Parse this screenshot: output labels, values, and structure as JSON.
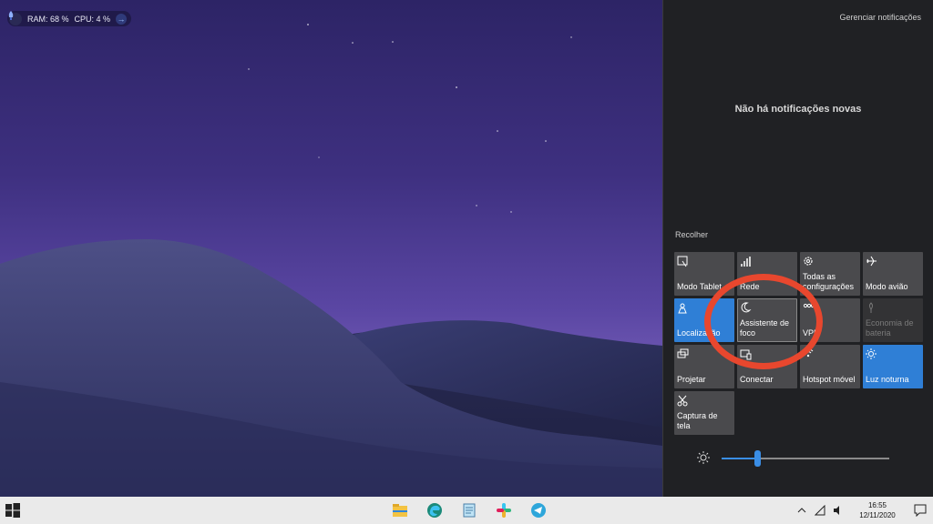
{
  "monitor": {
    "ram": "RAM: 68 %",
    "cpu": "CPU: 4 %"
  },
  "action_center": {
    "manage_link": "Gerenciar notificações",
    "empty_message": "Não há notificações novas",
    "collapse_link": "Recolher",
    "tiles": [
      {
        "label": "Modo Tablet",
        "icon": "tablet-mode-icon",
        "state": "off"
      },
      {
        "label": "Rede",
        "icon": "network-icon",
        "state": "off"
      },
      {
        "label": "Todas as configurações",
        "icon": "settings-gear-icon",
        "state": "off"
      },
      {
        "label": "Modo avião",
        "icon": "airplane-icon",
        "state": "off"
      },
      {
        "label": "Localização",
        "icon": "location-icon",
        "state": "on"
      },
      {
        "label": "Assistente de foco",
        "icon": "moon-icon",
        "state": "off"
      },
      {
        "label": "VPN",
        "icon": "vpn-icon",
        "state": "off"
      },
      {
        "label": "Economia de bateria",
        "icon": "battery-saver-icon",
        "state": "disabled"
      },
      {
        "label": "Projetar",
        "icon": "project-icon",
        "state": "off"
      },
      {
        "label": "Conectar",
        "icon": "connect-icon",
        "state": "off"
      },
      {
        "label": "Hotspot móvel",
        "icon": "hotspot-icon",
        "state": "off"
      },
      {
        "label": "Luz noturna",
        "icon": "night-light-icon",
        "state": "on"
      },
      {
        "label": "Captura de tela",
        "icon": "screen-snip-icon",
        "state": "off"
      }
    ],
    "brightness_level": 0.21
  },
  "taskbar": {
    "apps": [
      "file-explorer-icon",
      "edge-icon",
      "notepad-icon",
      "slack-icon",
      "telegram-icon"
    ],
    "time": "16:55",
    "date": "12/11/2020"
  },
  "colors": {
    "accent": "#2f7fd6",
    "tile": "#4a4a4d",
    "panel": "#202124",
    "annotation": "#e8472e"
  }
}
